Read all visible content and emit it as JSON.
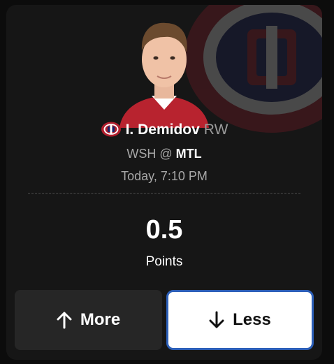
{
  "player": {
    "name": "I. Demidov",
    "position": "RW",
    "team_logo_icon": "canadiens-logo-icon",
    "photo_icon": "player-headshot-icon"
  },
  "game": {
    "away": "WSH",
    "separator": "@",
    "home": "MTL",
    "time": "Today, 7:10 PM"
  },
  "projection": {
    "value": "0.5",
    "stat": "Points"
  },
  "actions": {
    "more_label": "More",
    "less_label": "Less",
    "more_icon": "arrow-up-icon",
    "less_icon": "arrow-down-icon",
    "selected": "Less"
  },
  "colors": {
    "card_bg": "#161616",
    "selected_border": "#2c5fb8",
    "team_red": "#af1e2d",
    "team_blue": "#192168"
  }
}
